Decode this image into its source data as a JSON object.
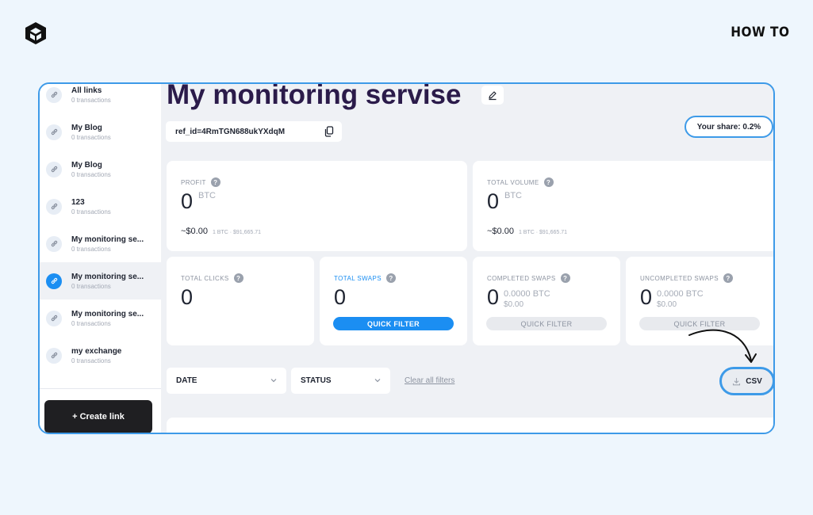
{
  "brand": {
    "logo_icon": "box-cube-logo-icon",
    "howto_label": "HOW TO"
  },
  "sidebar": {
    "items": [
      {
        "name": "All links",
        "sub": "0 transactions",
        "icon": "link-icon",
        "active": false
      },
      {
        "name": "My Blog",
        "sub": "0 transactions",
        "icon": "link-icon",
        "active": false
      },
      {
        "name": "My Blog",
        "sub": "0 transactions",
        "icon": "link-icon",
        "active": false
      },
      {
        "name": "123",
        "sub": "0 transactions",
        "icon": "link-icon",
        "active": false
      },
      {
        "name": "My monitoring se...",
        "sub": "0 transactions",
        "icon": "link-icon",
        "active": false
      },
      {
        "name": "My monitoring se...",
        "sub": "0 transactions",
        "icon": "link-icon",
        "active": true
      },
      {
        "name": "My monitoring se...",
        "sub": "0 transactions",
        "icon": "link-icon",
        "active": false
      },
      {
        "name": "my exchange",
        "sub": "0 transactions",
        "icon": "link-icon",
        "active": false
      }
    ],
    "create_label": "+ Create link"
  },
  "header": {
    "title": "My monitoring servise",
    "ref_id": "ref_id=4RmTGN688ukYXdqM",
    "share_label": "Your share: 0.2%"
  },
  "stats": {
    "profit": {
      "label": "PROFIT",
      "value": "0",
      "unit": "BTC",
      "usd": "~$0.00",
      "rate": "1 BTC · $91,665.71"
    },
    "volume": {
      "label": "TOTAL VOLUME",
      "value": "0",
      "unit": "BTC",
      "usd": "~$0.00",
      "rate": "1 BTC · $91,665.71"
    },
    "clicks": {
      "label": "TOTAL CLICKS",
      "value": "0"
    },
    "swaps": {
      "label": "TOTAL SWAPS",
      "value": "0",
      "button": "QUICK FILTER"
    },
    "completed": {
      "label": "COMPLETED SWAPS",
      "value": "0",
      "btc": "0.0000 BTC",
      "usd": "$0.00",
      "button": "QUICK FILTER"
    },
    "uncompleted": {
      "label": "UNCOMPLETED SWAPS",
      "value": "0",
      "btc": "0.0000 BTC",
      "usd": "$0.00",
      "button": "QUICK FILTER"
    }
  },
  "filters": {
    "date_label": "DATE",
    "status_label": "STATUS",
    "clear_label": "Clear all filters",
    "csv_label": "CSV"
  },
  "colors": {
    "accent": "#1b8ef2",
    "highlight": "#3d9ae8",
    "title": "#2b1b4a"
  }
}
